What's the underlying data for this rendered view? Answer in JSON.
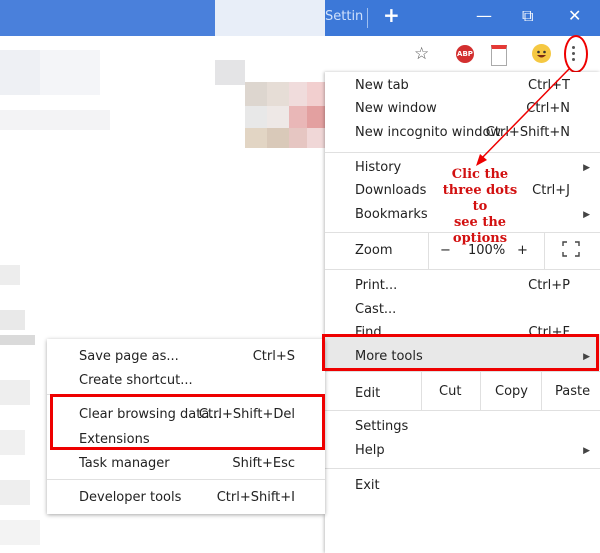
{
  "titlebar": {
    "tab_title": "Settin",
    "new_tab": "+",
    "minimize": "—",
    "restore": "⧉",
    "close": "✕"
  },
  "toolbar": {
    "star": "☆",
    "abp": "ABP"
  },
  "menu": {
    "items": [
      {
        "label": "New tab",
        "shortcut": "Ctrl+T"
      },
      {
        "label": "New window",
        "shortcut": "Ctrl+N"
      },
      {
        "label": "New incognito window",
        "shortcut": "Ctrl+Shift+N"
      },
      {
        "label": "History",
        "shortcut": ""
      },
      {
        "label": "Downloads",
        "shortcut": "Ctrl+J"
      },
      {
        "label": "Bookmarks",
        "shortcut": ""
      },
      {
        "label": "Print...",
        "shortcut": "Ctrl+P"
      },
      {
        "label": "Cast...",
        "shortcut": ""
      },
      {
        "label": "Find...",
        "shortcut": "Ctrl+F"
      },
      {
        "label": "More tools",
        "shortcut": ""
      },
      {
        "label": "Settings",
        "shortcut": ""
      },
      {
        "label": "Help",
        "shortcut": ""
      },
      {
        "label": "Exit",
        "shortcut": ""
      }
    ],
    "zoom": {
      "label": "Zoom",
      "minus": "−",
      "value": "100%",
      "plus": "+"
    },
    "edit": {
      "label": "Edit",
      "cut": "Cut",
      "copy": "Copy",
      "paste": "Paste"
    }
  },
  "annotation": {
    "line1": "Clic the",
    "line2": "three dots to",
    "line3": "see the",
    "line4": "options"
  },
  "submenu": {
    "items": [
      {
        "label": "Save page as...",
        "shortcut": "Ctrl+S"
      },
      {
        "label": "Create shortcut...",
        "shortcut": ""
      },
      {
        "label": "Clear browsing data...",
        "shortcut": "Ctrl+Shift+Del"
      },
      {
        "label": "Extensions",
        "shortcut": ""
      },
      {
        "label": "Task manager",
        "shortcut": "Shift+Esc"
      },
      {
        "label": "Developer tools",
        "shortcut": "Ctrl+Shift+I"
      }
    ]
  },
  "colors": {
    "accent": "#3c78d8",
    "highlight": "#e00000",
    "annotation_text": "#d21010"
  }
}
